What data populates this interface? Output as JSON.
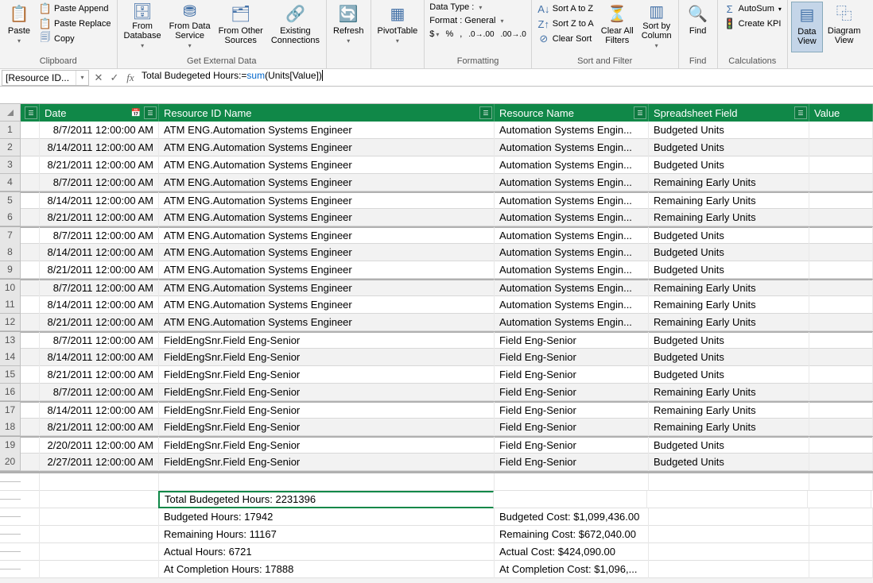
{
  "ribbon": {
    "clipboard": {
      "paste": "Paste",
      "paste_append": "Paste Append",
      "paste_replace": "Paste Replace",
      "copy": "Copy",
      "label": "Clipboard"
    },
    "external": {
      "from_db": "From\nDatabase",
      "from_ds": "From Data\nService",
      "from_other": "From Other\nSources",
      "existing": "Existing\nConnections",
      "label": "Get External Data"
    },
    "refresh": "Refresh",
    "pivot": "PivotTable",
    "formatting": {
      "data_type": "Data Type :",
      "format": "Format : General",
      "label": "Formatting"
    },
    "sort": {
      "az": "Sort A to Z",
      "za": "Sort Z to A",
      "clear": "Clear Sort",
      "clear_filters": "Clear All\nFilters",
      "sort_by": "Sort by\nColumn",
      "label": "Sort and Filter"
    },
    "find": {
      "find": "Find",
      "label": "Find"
    },
    "calc": {
      "autosum": "AutoSum",
      "kpi": "Create KPI",
      "label": "Calculations"
    },
    "view": {
      "data": "Data\nView",
      "diagram": "Diagram\nView"
    }
  },
  "formula_bar": {
    "name_box": "[Resource ID...",
    "formula_prefix": "Total Budegeted Hours:=",
    "formula_func": "sum",
    "formula_arg": "(Units[Value])"
  },
  "columns": {
    "date": "Date",
    "resid": "Resource ID Name",
    "resname": "Resource Name",
    "field": "Spreadsheet Field",
    "value": "Value"
  },
  "rows": [
    {
      "n": "1",
      "date": "8/7/2011 12:00:00 AM",
      "resid": "ATM ENG.Automation Systems Engineer",
      "resname": "Automation Systems Engin...",
      "field": "Budgeted Units"
    },
    {
      "n": "2",
      "date": "8/14/2011 12:00:00 AM",
      "resid": "ATM ENG.Automation Systems Engineer",
      "resname": "Automation Systems Engin...",
      "field": "Budgeted Units"
    },
    {
      "n": "3",
      "date": "8/21/2011 12:00:00 AM",
      "resid": "ATM ENG.Automation Systems Engineer",
      "resname": "Automation Systems Engin...",
      "field": "Budgeted Units"
    },
    {
      "n": "4",
      "date": "8/7/2011 12:00:00 AM",
      "resid": "ATM ENG.Automation Systems Engineer",
      "resname": "Automation Systems Engin...",
      "field": "Remaining Early Units"
    },
    {
      "n": "5",
      "date": "8/14/2011 12:00:00 AM",
      "resid": "ATM ENG.Automation Systems Engineer",
      "resname": "Automation Systems Engin...",
      "field": "Remaining Early Units"
    },
    {
      "n": "6",
      "date": "8/21/2011 12:00:00 AM",
      "resid": "ATM ENG.Automation Systems Engineer",
      "resname": "Automation Systems Engin...",
      "field": "Remaining Early Units"
    },
    {
      "n": "7",
      "date": "8/7/2011 12:00:00 AM",
      "resid": "ATM ENG.Automation Systems Engineer",
      "resname": "Automation Systems Engin...",
      "field": "Budgeted Units"
    },
    {
      "n": "8",
      "date": "8/14/2011 12:00:00 AM",
      "resid": "ATM ENG.Automation Systems Engineer",
      "resname": "Automation Systems Engin...",
      "field": "Budgeted Units"
    },
    {
      "n": "9",
      "date": "8/21/2011 12:00:00 AM",
      "resid": "ATM ENG.Automation Systems Engineer",
      "resname": "Automation Systems Engin...",
      "field": "Budgeted Units"
    },
    {
      "n": "10",
      "date": "8/7/2011 12:00:00 AM",
      "resid": "ATM ENG.Automation Systems Engineer",
      "resname": "Automation Systems Engin...",
      "field": "Remaining Early Units"
    },
    {
      "n": "11",
      "date": "8/14/2011 12:00:00 AM",
      "resid": "ATM ENG.Automation Systems Engineer",
      "resname": "Automation Systems Engin...",
      "field": "Remaining Early Units"
    },
    {
      "n": "12",
      "date": "8/21/2011 12:00:00 AM",
      "resid": "ATM ENG.Automation Systems Engineer",
      "resname": "Automation Systems Engin...",
      "field": "Remaining Early Units"
    },
    {
      "n": "13",
      "date": "8/7/2011 12:00:00 AM",
      "resid": "FieldEngSnr.Field Eng-Senior",
      "resname": "Field Eng-Senior",
      "field": "Budgeted Units"
    },
    {
      "n": "14",
      "date": "8/14/2011 12:00:00 AM",
      "resid": "FieldEngSnr.Field Eng-Senior",
      "resname": "Field Eng-Senior",
      "field": "Budgeted Units"
    },
    {
      "n": "15",
      "date": "8/21/2011 12:00:00 AM",
      "resid": "FieldEngSnr.Field Eng-Senior",
      "resname": "Field Eng-Senior",
      "field": "Budgeted Units"
    },
    {
      "n": "16",
      "date": "8/7/2011 12:00:00 AM",
      "resid": "FieldEngSnr.Field Eng-Senior",
      "resname": "Field Eng-Senior",
      "field": "Remaining Early Units"
    },
    {
      "n": "17",
      "date": "8/14/2011 12:00:00 AM",
      "resid": "FieldEngSnr.Field Eng-Senior",
      "resname": "Field Eng-Senior",
      "field": "Remaining Early Units"
    },
    {
      "n": "18",
      "date": "8/21/2011 12:00:00 AM",
      "resid": "FieldEngSnr.Field Eng-Senior",
      "resname": "Field Eng-Senior",
      "field": "Remaining Early Units"
    },
    {
      "n": "19",
      "date": "2/20/2011 12:00:00 AM",
      "resid": "FieldEngSnr.Field Eng-Senior",
      "resname": "Field Eng-Senior",
      "field": "Budgeted Units"
    },
    {
      "n": "20",
      "date": "2/27/2011 12:00:00 AM",
      "resid": "FieldEngSnr.Field Eng-Senior",
      "resname": "Field Eng-Senior",
      "field": "Budgeted Units"
    }
  ],
  "summary": {
    "total_budgeted": "Total Budegeted Hours: 2231396",
    "budgeted_hours": "Budgeted Hours: 17942",
    "remaining_hours": "Remaining Hours: 11167",
    "actual_hours": "Actual Hours: 6721",
    "completion_hours": "At Completion Hours: 17888",
    "budgeted_cost": "Budgeted Cost: $1,099,436.00",
    "remaining_cost": "Remaining Cost: $672,040.00",
    "actual_cost": "Actual Cost: $424,090.00",
    "completion_cost": "At Completion Cost: $1,096,..."
  }
}
